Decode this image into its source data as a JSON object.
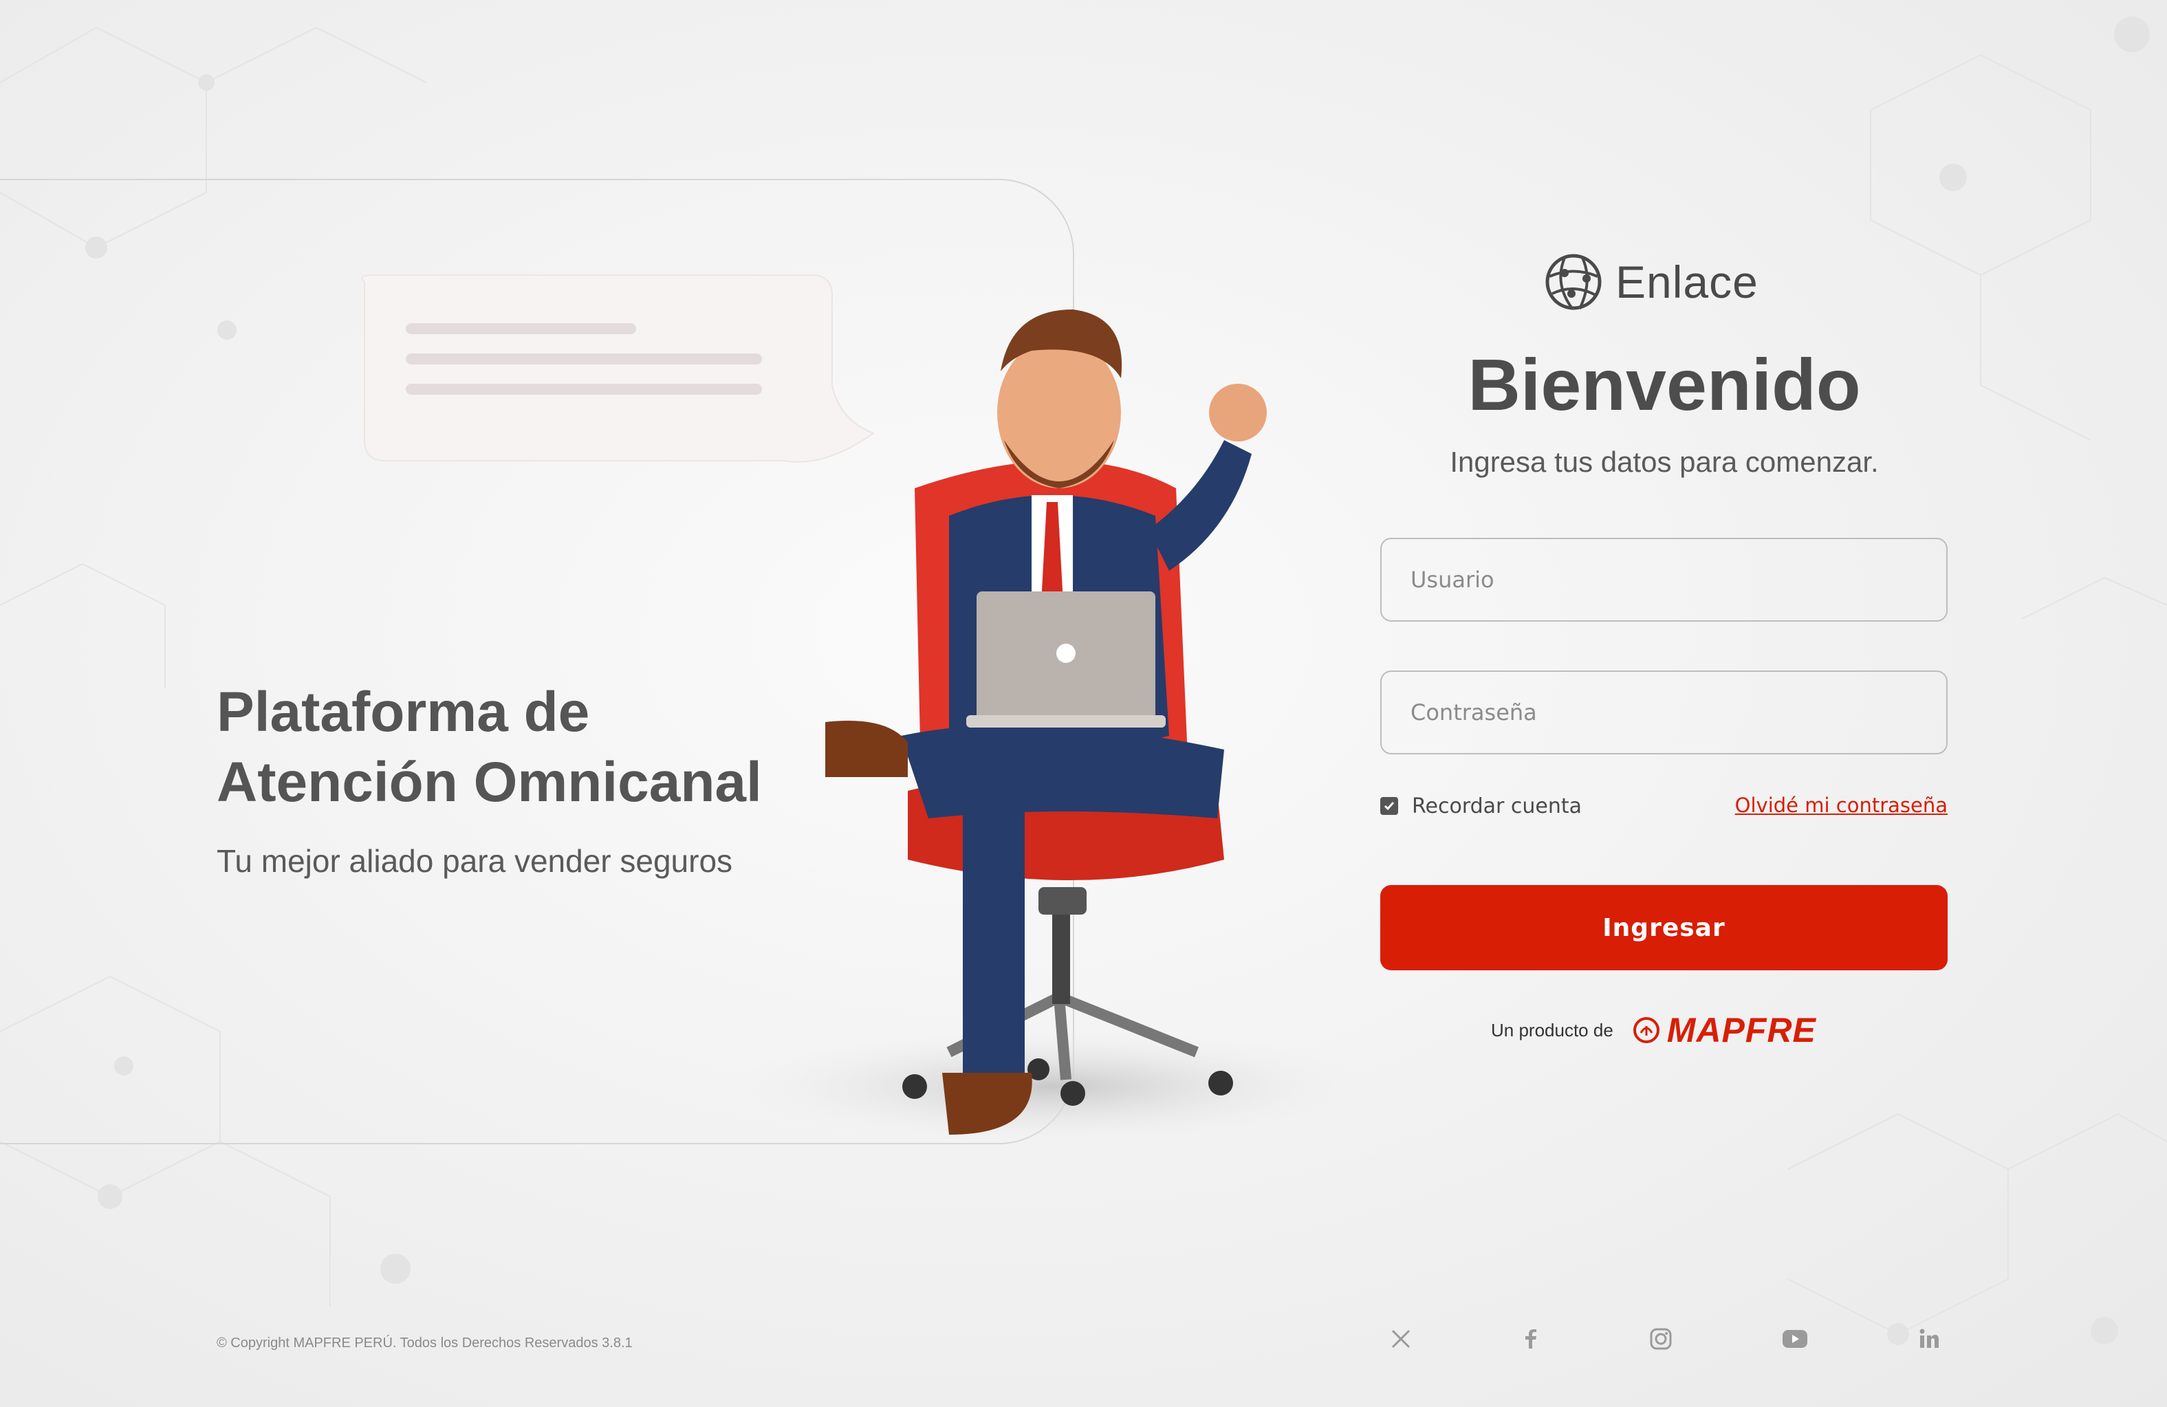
{
  "app": {
    "name": "Enlace"
  },
  "hero": {
    "title_line1": "Plataforma de",
    "title_line2": "Atención Omnicanal",
    "subtitle": "Tu mejor aliado para vender seguros"
  },
  "login": {
    "title": "Bienvenido",
    "subtitle": "Ingresa tus datos para comenzar.",
    "username": {
      "value": "",
      "placeholder": "Usuario"
    },
    "password": {
      "value": "",
      "placeholder": "Contraseña"
    },
    "remember": {
      "label": "Recordar cuenta",
      "checked": true
    },
    "forgot_label": "Olvidé mi contraseña",
    "submit_label": "Ingresar"
  },
  "product": {
    "label": "Un producto de",
    "brand": "MAPFRE"
  },
  "footer": {
    "copyright": "© Copyright MAPFRE PERÚ. Todos los Derechos Reservados 3.8.1",
    "social": [
      "x-icon",
      "facebook-icon",
      "instagram-icon",
      "youtube-icon",
      "linkedin-icon"
    ]
  },
  "colors": {
    "accent": "#d81e05",
    "text": "#4d4d4d",
    "muted": "#8a8a8a",
    "background": "#f1f1f1"
  }
}
